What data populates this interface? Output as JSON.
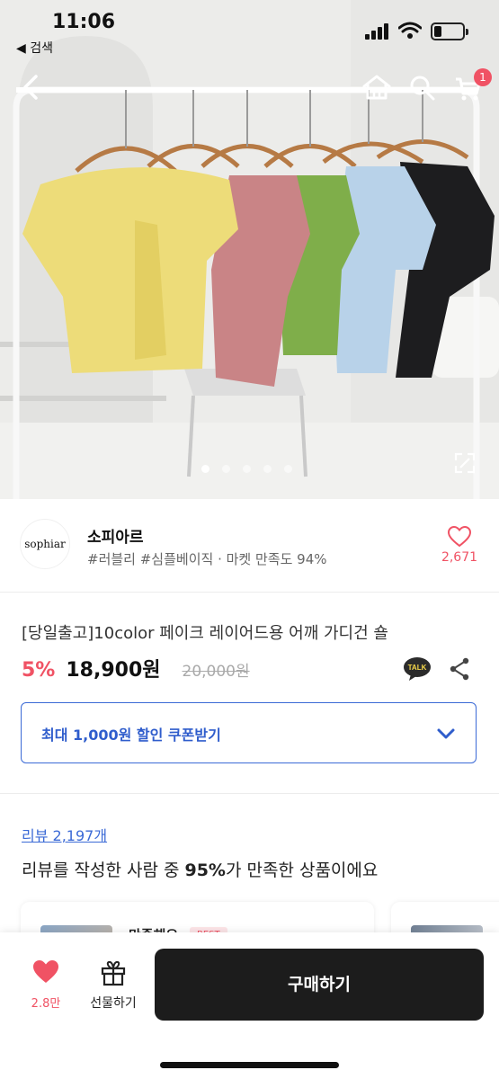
{
  "status_bar": {
    "time": "11:06",
    "back_label": "◀ 검색",
    "battery_level": 0.2
  },
  "header": {
    "cart_count": "1"
  },
  "hero": {
    "image_count": 5,
    "active_index": 0
  },
  "shop": {
    "logo_text": "sophiar",
    "name": "소피아르",
    "tags": "#러블리 #심플베이직 · 마켓 만족도 94%",
    "likes": "2,671"
  },
  "product": {
    "title": "[당일출고]10color 페이크 레이어드용 어깨 가디건 숄",
    "discount": "5%",
    "price": "18,900원",
    "original_price": "20,000원",
    "talk_label": "TALK"
  },
  "coupon": {
    "label": "최대 1,000원 할인 쿠폰받기"
  },
  "reviews": {
    "link": "리뷰 2,197개",
    "summary_before": "리뷰를 작성한 사람 중 ",
    "summary_pct": "95%",
    "summary_after": "가 만족한 상품이에요",
    "card1_title": "만족해요",
    "card1_badge": "BEST"
  },
  "bottom_bar": {
    "likes": "2.8만",
    "gift_label": "선물하기",
    "buy_label": "구매하기"
  },
  "colors": {
    "accent_pink": "#f05264",
    "coupon_blue": "#3b6ad6",
    "buy_button": "#1c1c1c",
    "talk_yellow": "#2b2b2b"
  }
}
